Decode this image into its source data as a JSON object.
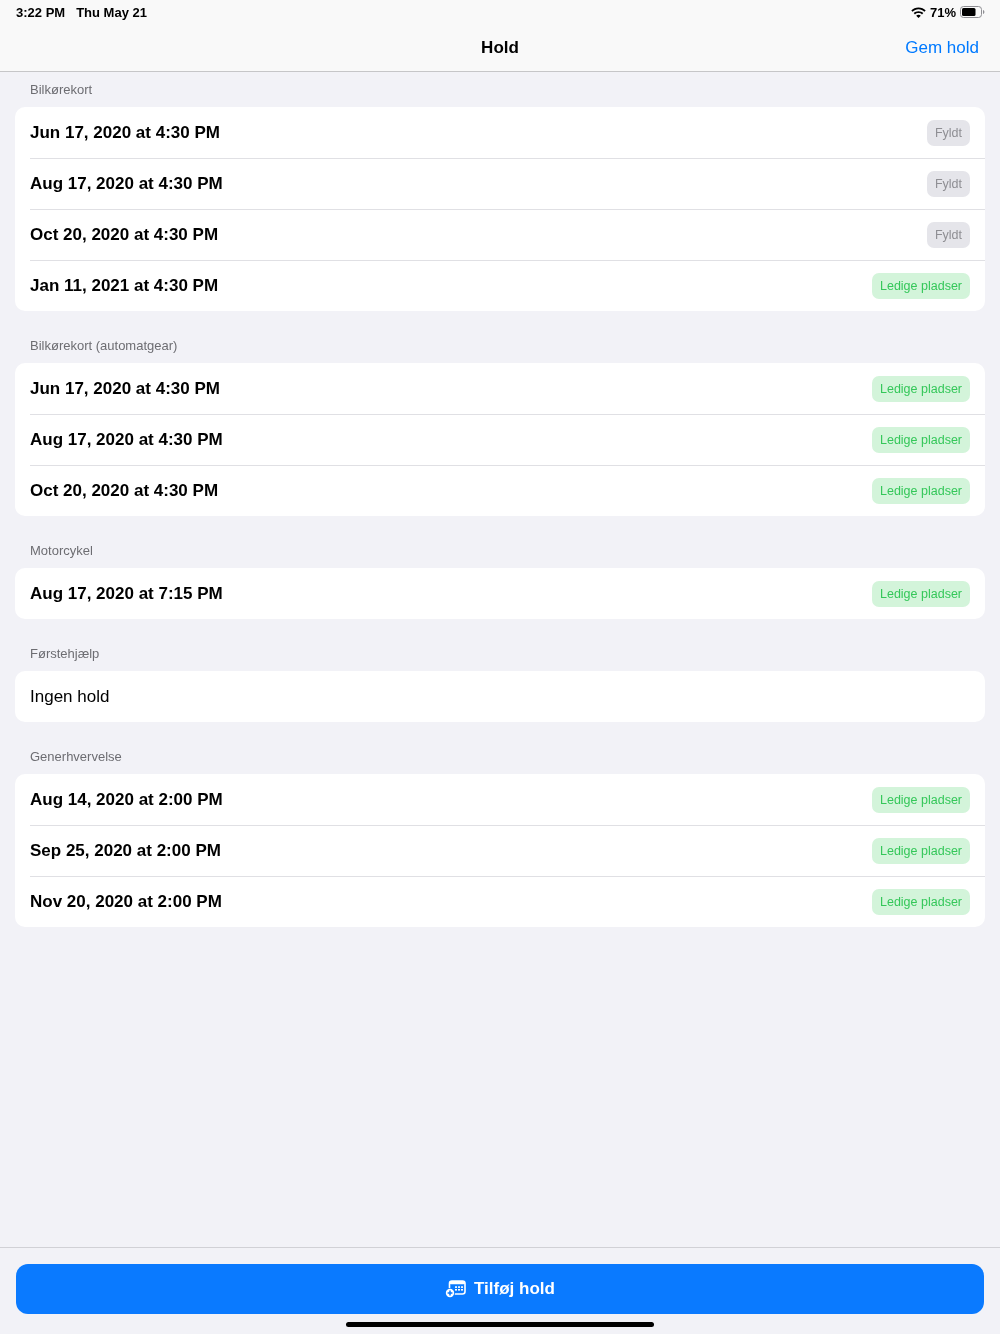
{
  "status_bar": {
    "time": "3:22 PM",
    "date": "Thu May 21",
    "battery": "71%"
  },
  "nav_bar": {
    "title": "Hold",
    "action": "Gem hold"
  },
  "sections": [
    {
      "title": "Bilkørekort",
      "rows": [
        {
          "kind": "session",
          "label": "Jun 17, 2020 at 4:30 PM",
          "badge": {
            "kind": "full",
            "label": "Fyldt"
          }
        },
        {
          "kind": "session",
          "label": "Aug 17, 2020 at 4:30 PM",
          "badge": {
            "kind": "full",
            "label": "Fyldt"
          }
        },
        {
          "kind": "session",
          "label": "Oct 20, 2020 at 4:30 PM",
          "badge": {
            "kind": "full",
            "label": "Fyldt"
          }
        },
        {
          "kind": "session",
          "label": "Jan 11, 2021 at 4:30 PM",
          "badge": {
            "kind": "available",
            "label": "Ledige pladser"
          }
        }
      ]
    },
    {
      "title": "Bilkørekort (automatgear)",
      "rows": [
        {
          "kind": "session",
          "label": "Jun 17, 2020 at 4:30 PM",
          "badge": {
            "kind": "available",
            "label": "Ledige pladser"
          }
        },
        {
          "kind": "session",
          "label": "Aug 17, 2020 at 4:30 PM",
          "badge": {
            "kind": "available",
            "label": "Ledige pladser"
          }
        },
        {
          "kind": "session",
          "label": "Oct 20, 2020 at 4:30 PM",
          "badge": {
            "kind": "available",
            "label": "Ledige pladser"
          }
        }
      ]
    },
    {
      "title": "Motorcykel",
      "rows": [
        {
          "kind": "session",
          "label": "Aug 17, 2020 at 7:15 PM",
          "badge": {
            "kind": "available",
            "label": "Ledige pladser"
          }
        }
      ]
    },
    {
      "title": "Førstehjælp",
      "rows": [
        {
          "kind": "empty",
          "label": "Ingen hold"
        }
      ]
    },
    {
      "title": "Generhvervelse",
      "rows": [
        {
          "kind": "session",
          "label": "Aug 14, 2020 at 2:00 PM",
          "badge": {
            "kind": "available",
            "label": "Ledige pladser"
          }
        },
        {
          "kind": "session",
          "label": "Sep 25, 2020 at 2:00 PM",
          "badge": {
            "kind": "available",
            "label": "Ledige pladser"
          }
        },
        {
          "kind": "session",
          "label": "Nov 20, 2020 at 2:00 PM",
          "badge": {
            "kind": "available",
            "label": "Ledige pladser"
          }
        }
      ]
    }
  ],
  "add_button": {
    "label": "Tilføj hold"
  }
}
